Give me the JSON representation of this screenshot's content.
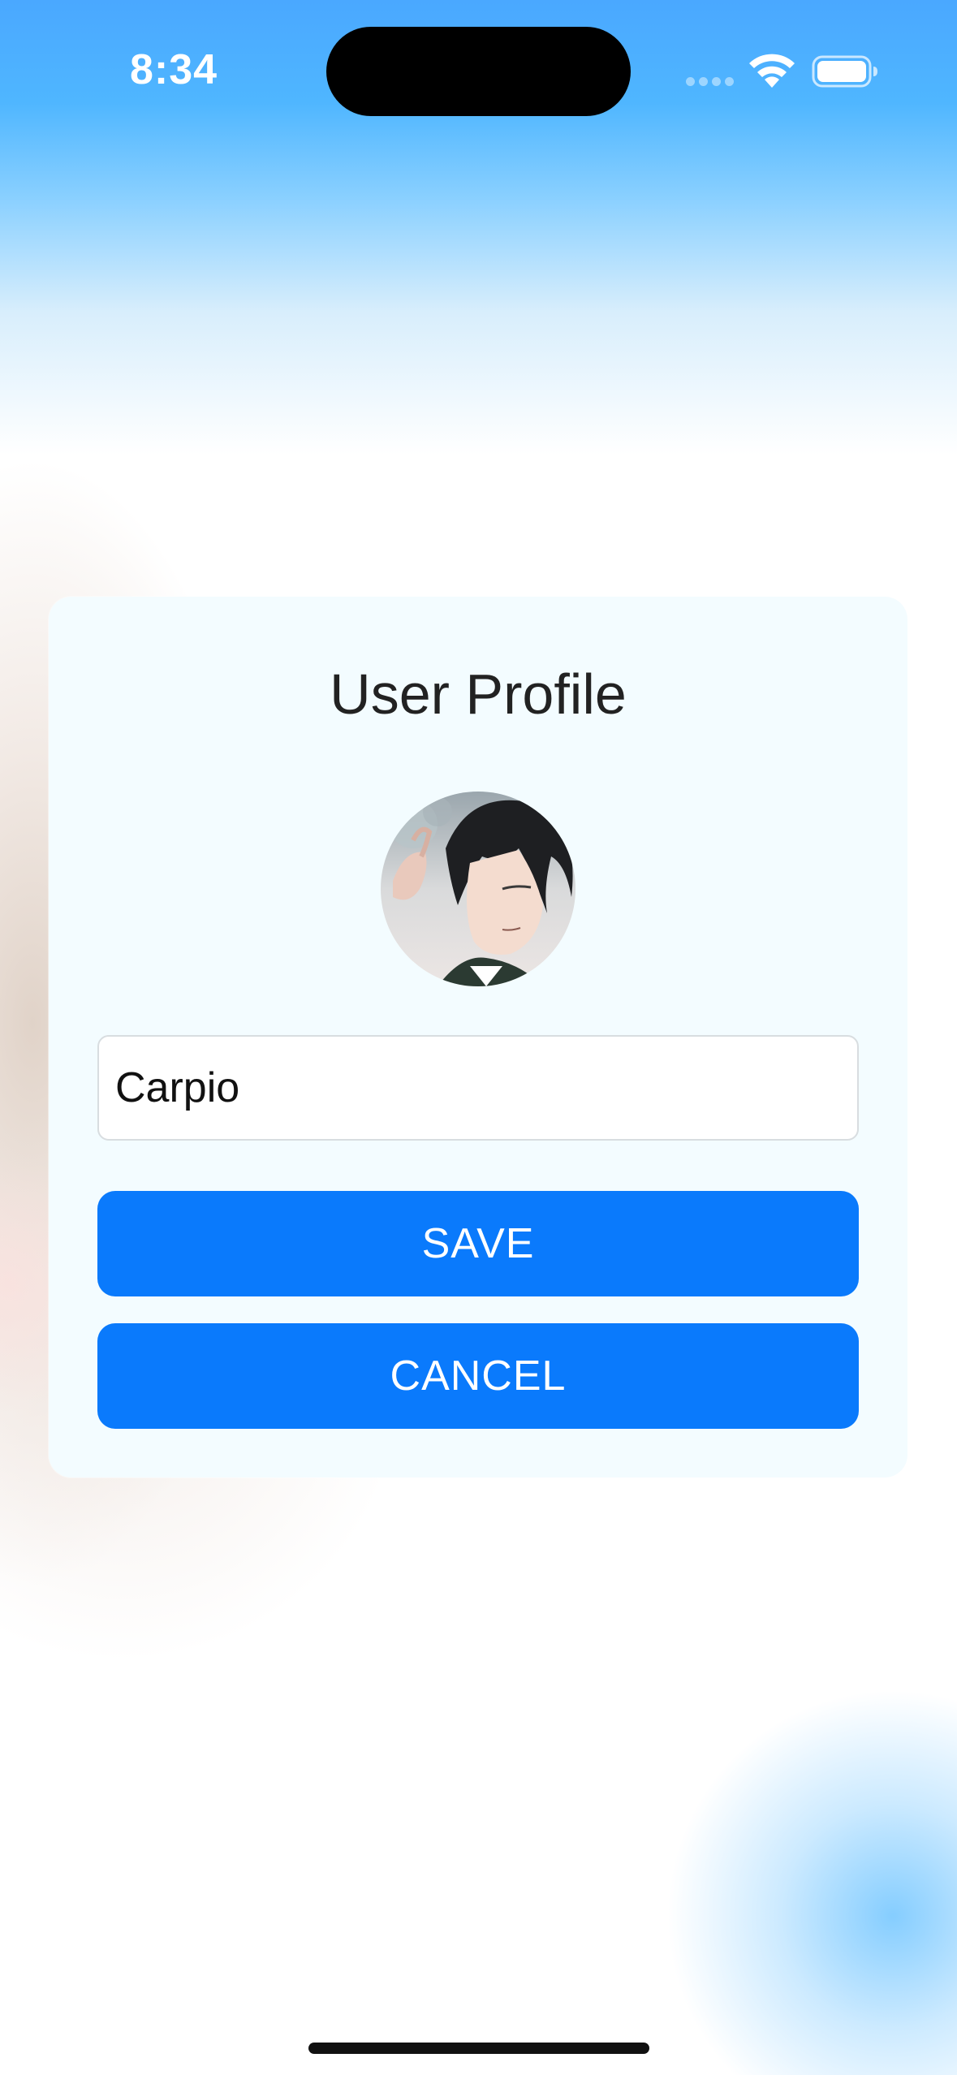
{
  "status_bar": {
    "time": "8:34",
    "wifi_icon": "wifi-icon",
    "battery_icon": "battery-icon",
    "cellular_icon": "cellular-dots-icon"
  },
  "profile_card": {
    "title": "User Profile",
    "avatar": "avatar-image",
    "name_input": {
      "value": "Carpio",
      "placeholder": ""
    },
    "save_label": "SAVE",
    "cancel_label": "CANCEL"
  },
  "colors": {
    "button_blue": "#0a7afc",
    "card_background": "#f3fcff",
    "wallpaper_top": "#4aa8ff"
  }
}
